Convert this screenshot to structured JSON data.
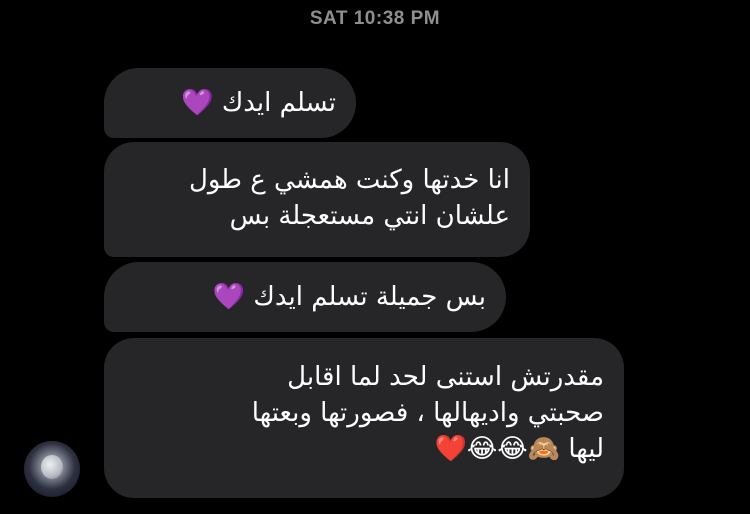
{
  "timestamp": "SAT 10:38 PM",
  "messages": [
    {
      "lines": [
        "تسلم ايدك 💜"
      ]
    },
    {
      "lines": [
        "انا خدتها وكنت همشي ع طول",
        "علشان انتي مستعجلة بس"
      ]
    },
    {
      "lines": [
        "بس جميلة تسلم ايدك 💜"
      ]
    },
    {
      "lines": [
        "مقدرتش استنى لحد لما اقابل",
        "صحبتي واديهالها ، فصورتها وبعتها",
        "ليها 🙈😂😂❤️"
      ]
    }
  ],
  "colors": {
    "background": "#000000",
    "bubble": "#262628",
    "timestamp": "#8e8e93",
    "text": "#ffffff"
  }
}
